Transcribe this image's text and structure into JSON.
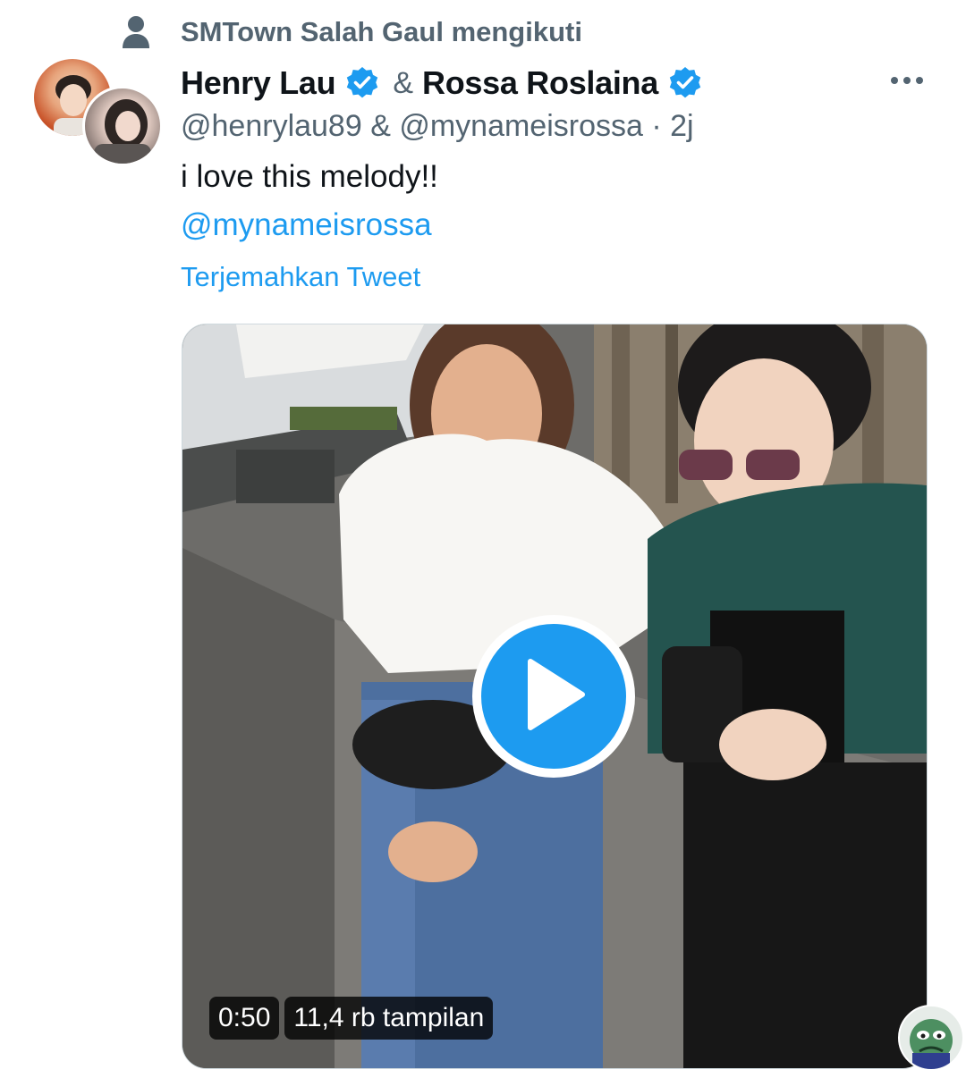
{
  "social_context": {
    "text": "SMTown Salah Gaul mengikuti",
    "icon": "person-icon"
  },
  "tweet": {
    "author1": {
      "name": "Henry Lau",
      "verified": true
    },
    "separator": "&",
    "author2": {
      "name": "Rossa Roslaina",
      "verified": true
    },
    "handles_line": "@henrylau89 & @mynameisrossa · 2j",
    "text": "i love this melody!!",
    "mention": "@mynameisrossa",
    "translate_label": "Terjemahkan Tweet",
    "more_icon": "more-options-icon"
  },
  "video": {
    "duration": "0:50",
    "views": "11,4 rb tampilan",
    "play_icon": "play-icon"
  },
  "colors": {
    "accent": "#1d9bf0",
    "secondary_text": "#536471",
    "primary_text": "#0f1419"
  }
}
